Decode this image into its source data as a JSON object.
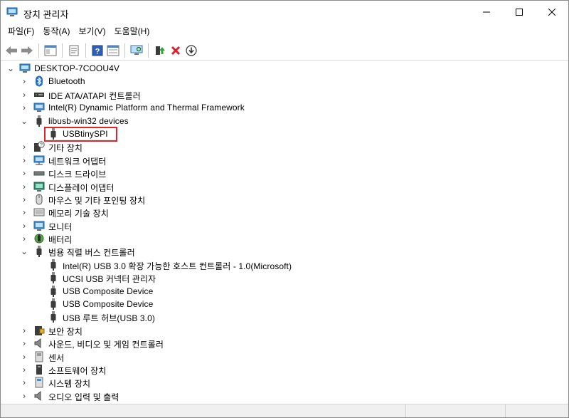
{
  "window": {
    "title": "장치 관리자"
  },
  "menu": [
    "파일(F)",
    "동작(A)",
    "보기(V)",
    "도움말(H)"
  ],
  "tree": {
    "root": "DESKTOP-7COOU4V",
    "categories": [
      {
        "label": "Bluetooth",
        "icon": "bluetooth-icon"
      },
      {
        "label": "IDE ATA/ATAPI 컨트롤러",
        "icon": "ide-controller-icon"
      },
      {
        "label": "Intel(R) Dynamic Platform and Thermal Framework",
        "icon": "computer-icon"
      },
      {
        "label": "libusb-win32 devices",
        "icon": "usb-plug-icon",
        "expanded": true,
        "children": [
          {
            "label": "USBtinySPI",
            "icon": "usb-plug-icon",
            "highlighted": true
          }
        ]
      },
      {
        "label": "기타 장치",
        "icon": "unknown-device-icon"
      },
      {
        "label": "네트워크 어댑터",
        "icon": "network-adapter-icon"
      },
      {
        "label": "디스크 드라이브",
        "icon": "disk-drive-icon"
      },
      {
        "label": "디스플레이 어댑터",
        "icon": "display-adapter-icon"
      },
      {
        "label": "마우스 및 기타 포인팅 장치",
        "icon": "mouse-icon"
      },
      {
        "label": "메모리 기술 장치",
        "icon": "memory-icon"
      },
      {
        "label": "모니터",
        "icon": "monitor-icon"
      },
      {
        "label": "배터리",
        "icon": "battery-icon"
      },
      {
        "label": "범용 직렬 버스 컨트롤러",
        "icon": "usb-plug-icon",
        "expanded": true,
        "children": [
          {
            "label": "Intel(R) USB 3.0 확장 가능한 호스트 컨트롤러 - 1.0(Microsoft)",
            "icon": "usb-plug-icon"
          },
          {
            "label": "UCSI USB 커넥터 관리자",
            "icon": "usb-plug-icon"
          },
          {
            "label": "USB Composite Device",
            "icon": "usb-plug-icon"
          },
          {
            "label": "USB Composite Device",
            "icon": "usb-plug-icon"
          },
          {
            "label": "USB 루트 허브(USB 3.0)",
            "icon": "usb-plug-icon"
          }
        ]
      },
      {
        "label": "보안 장치",
        "icon": "security-device-icon"
      },
      {
        "label": "사운드, 비디오 및 게임 컨트롤러",
        "icon": "speaker-icon"
      },
      {
        "label": "센서",
        "icon": "sensor-icon"
      },
      {
        "label": "소프트웨어 장치",
        "icon": "software-device-icon"
      },
      {
        "label": "시스템 장치",
        "icon": "system-device-icon"
      },
      {
        "label": "오디오 입력 및 출력",
        "icon": "audio-io-icon"
      }
    ]
  },
  "colors": {
    "highlight_border": "#e8202a",
    "accent": "#1e6fc8"
  }
}
